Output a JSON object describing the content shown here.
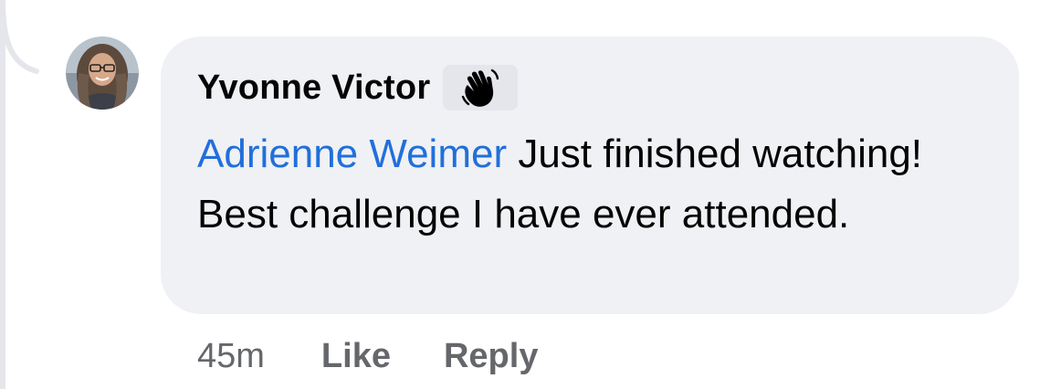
{
  "comment": {
    "author": "Yvonne Victor",
    "badge_icon": "waving-hand-icon",
    "mention": "Adrienne Weimer",
    "text": " Just finished watching!  Best challenge I have ever attended."
  },
  "actions": {
    "timestamp": "45m",
    "like_label": "Like",
    "reply_label": "Reply"
  },
  "colors": {
    "bubble": "#f0f1f4",
    "mention": "#216fdb",
    "meta_text": "#65676b",
    "thread_line": "#e4e6eb"
  }
}
